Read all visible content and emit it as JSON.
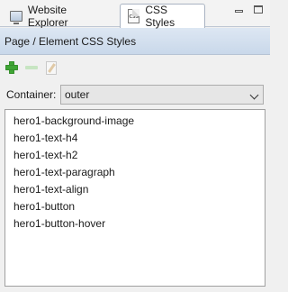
{
  "tabs": [
    {
      "label": "Website Explorer",
      "icon": "monitor-icon",
      "active": false
    },
    {
      "label": "CSS Styles",
      "icon": "css-file-icon",
      "active": true
    }
  ],
  "tab_icon_text": "CSS",
  "header": {
    "title": "Page / Element CSS Styles"
  },
  "toolbar": {
    "add_icon": "add-plus-icon",
    "remove_icon": "remove-minus-icon",
    "edit_icon": "edit-document-icon"
  },
  "container": {
    "label": "Container:",
    "selected": "outer"
  },
  "styles": [
    "hero1-background-image",
    "hero1-text-h4",
    "hero1-text-h2",
    "hero1-text-paragraph",
    "hero1-text-align",
    "hero1-button",
    "hero1-button-hover"
  ],
  "colors": {
    "header_bg": "#d4e0ee",
    "add_green": "#3fa535",
    "panel_bg": "#f0f0f0"
  }
}
